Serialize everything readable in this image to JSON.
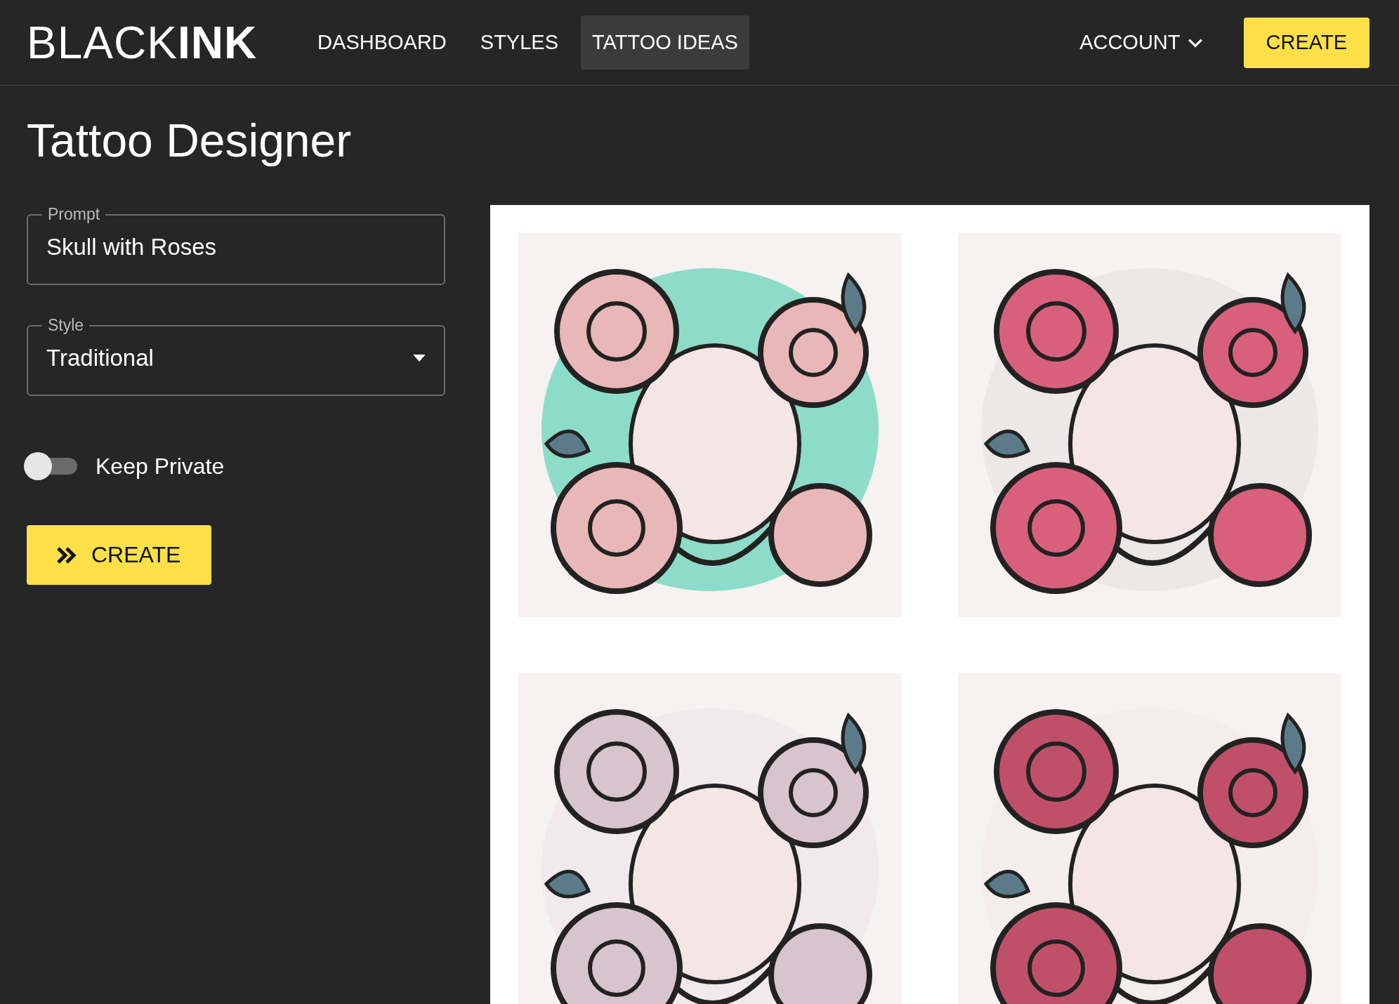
{
  "header": {
    "logo": "BLACK**INK**",
    "nav": [
      {
        "label": "DASHBOARD",
        "selected": false
      },
      {
        "label": "STYLES",
        "selected": false
      },
      {
        "label": "TATTOO IDEAS",
        "selected": true
      }
    ],
    "account": "ACCOUNT",
    "create_button": "CREATE"
  },
  "title": "Tattoo Designer",
  "form": {
    "prompt": {
      "label": "Prompt",
      "value": "Skull with Roses"
    },
    "style": {
      "label": "Style",
      "value": "Traditional"
    },
    "keep_private": {
      "label": "Keep Private",
      "on": false
    },
    "create_button": "CREATE"
  }
}
